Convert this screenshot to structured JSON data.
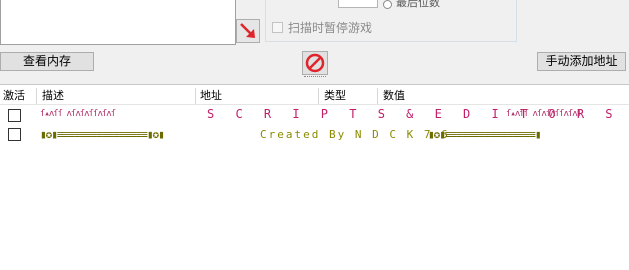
{
  "upper": {
    "radio_label": "最后位数",
    "pause_label": "扫描时暂停游戏"
  },
  "buttons": {
    "view_memory": "查看内存",
    "manual_add": "手动添加地址"
  },
  "icons": {
    "arrow": "red-diagonal-arrow-icon",
    "stop": "no-entry-icon"
  },
  "colors": {
    "arrow_red": "#e0242b",
    "pink_text": "#c0206a",
    "olive_text": "#8b8b00"
  },
  "table": {
    "headers": [
      "激活",
      "描述",
      "地址",
      "类型",
      "数值"
    ],
    "rows": [
      {
        "pattern_left": "ſ▴ʌſſ ʌſʌſʌſſʌſʌſ",
        "title": "S C R I P T S   &   E D I T O R S",
        "pattern_right": "ſ▴ʌſſ ʌſʌſʌſſʌſʌſ"
      },
      {
        "deco_left": "▮✪▮≡≡≡≡≡≡≡≡≡≡≡≡≡≡≡≡▮✪▮",
        "credit": "Created  By  N D C K 7 6",
        "deco_right": "▮✪▮≡≡≡≡≡≡≡≡≡≡≡≡≡≡≡≡▮"
      }
    ]
  }
}
